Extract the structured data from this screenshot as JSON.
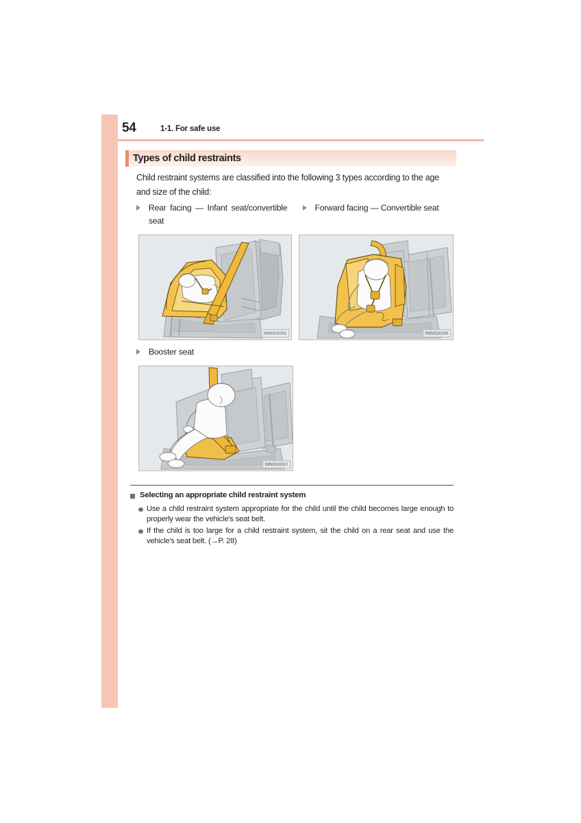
{
  "page": {
    "folio": "54",
    "section_label": "1-1. For safe use",
    "accent_color": "#f5c6b4",
    "heading_tab_color": "#e98f74",
    "rule_color": "#f5b9a4"
  },
  "heading": {
    "title": "Types of child restraints"
  },
  "intro": {
    "text": "Child restraint systems are classified into the following 3 types according to the age and size of the child:"
  },
  "restraint_types": [
    {
      "id": "rear-facing",
      "label": "Rear facing — Infant seat/convertible seat",
      "figure_code": "INNIGX003"
    },
    {
      "id": "forward-facing",
      "label": "Forward facing — Convertible seat",
      "figure_code": "INNIGX009"
    },
    {
      "id": "booster",
      "label": "Booster seat",
      "figure_code": "INNIGX010"
    }
  ],
  "notes": {
    "heading": "Selecting an appropriate child restraint system",
    "items": [
      "Use a child restraint system appropriate for the child until the child becomes large enough to properly wear the vehicle's seat belt.",
      "If the child is too large for a child restraint system, sit the child on a rear seat and use the vehicle's seat belt. (→P. 28)"
    ]
  },
  "icons": {
    "triangle_bullet": "triangle-right-bullet",
    "square_bullet": "square-bullet",
    "round_bullet": "round-bullet"
  }
}
